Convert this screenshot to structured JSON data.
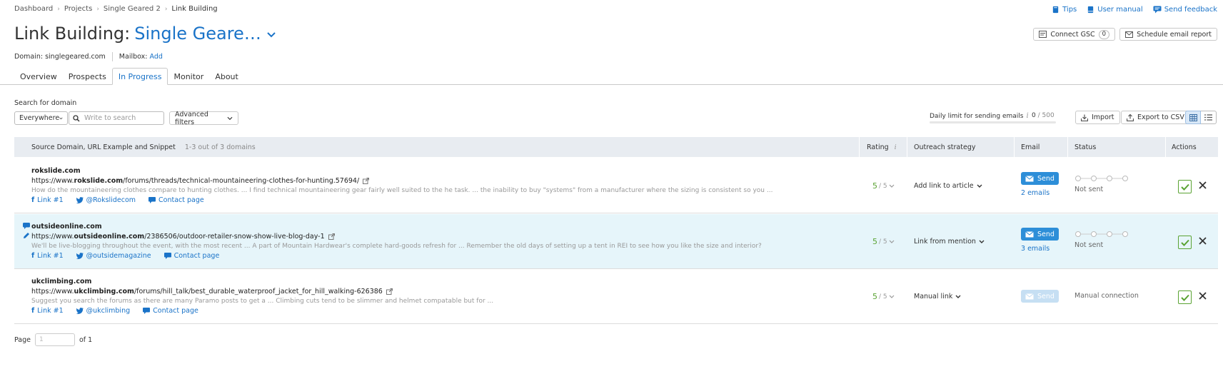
{
  "breadcrumb": [
    "Dashboard",
    "Projects",
    "Single Geared 2",
    "Link Building"
  ],
  "top_links": {
    "tips": "Tips",
    "manual": "User manual",
    "feedback": "Send feedback"
  },
  "title": {
    "prefix": "Link Building:",
    "project": "Single Geare…"
  },
  "header_buttons": {
    "gsc": "Connect GSC",
    "gsc_count": "0",
    "schedule": "Schedule email report"
  },
  "meta": {
    "domain": "Domain: singlegeared.com",
    "mailbox_label": "Mailbox:",
    "mailbox_add": "Add"
  },
  "tabs": [
    {
      "label": "Overview"
    },
    {
      "label": "Prospects"
    },
    {
      "label": "In Progress"
    },
    {
      "label": "Monitor"
    },
    {
      "label": "About"
    }
  ],
  "search": {
    "label": "Search for domain",
    "scope": "Everywhere",
    "placeholder": "Write to search",
    "advanced": "Advanced filters"
  },
  "daily_limit": {
    "label": "Daily limit for sending emails",
    "used": "0",
    "sep": "/",
    "total": "500",
    "progress": 0
  },
  "actions": {
    "import": "Import",
    "export": "Export to CSV"
  },
  "table": {
    "headers": {
      "source": "Source Domain, URL Example and Snippet",
      "count": "1-3 out of 3 domains",
      "rating": "Rating",
      "strategy": "Outreach strategy",
      "email": "Email",
      "status": "Status",
      "actions": "Actions"
    },
    "rows": [
      {
        "domain": "rokslide.com",
        "url_prefix": "https://www.",
        "url_domain": "rokslide.com",
        "url_path": "/forums/threads/technical-mountaineering-clothes-for-hunting.57694/",
        "snippet": "How do the mountaineering clothes compare to hunting clothes. ... I find technical mountaineering gear fairly well suited to the he task. ... the inability to buy \"systems\" from a manufacturer where the sizing is consistent so you ...",
        "link": "Link #1",
        "twitter": "@Rokslidecom",
        "contact": "Contact page",
        "rating": "5",
        "rating_of": "/ 5",
        "strategy": "Add link to article",
        "send": "Send",
        "emails": "2 emails",
        "status": "Not sent"
      },
      {
        "domain": "outsideonline.com",
        "url_prefix": "https://www.",
        "url_domain": "outsideonline.com",
        "url_path": "/2386506/outdoor-retailer-snow-show-live-blog-day-1",
        "snippet": "We'll be live-blogging throughout the event, with the most recent ... A part of Mountain Hardwear's complete hard-goods refresh for ... Remember the old days of setting up a tent in REI to see how you like the size and interior?",
        "link": "Link #1",
        "twitter": "@outsidemagazine",
        "contact": "Contact page",
        "rating": "5",
        "rating_of": "/ 5",
        "strategy": "Link from mention",
        "send": "Send",
        "emails": "3 emails",
        "status": "Not sent"
      },
      {
        "domain": "ukclimbing.com",
        "url_prefix": "https://www.",
        "url_domain": "ukclimbing.com",
        "url_path": "/forums/hill_talk/best_durable_waterproof_jacket_for_hill_walking-626386",
        "snippet": "Suggest you search the forums as there are many Paramo posts to get a ... Climbing cuts tend to be slimmer and helmet compatable but for ...",
        "link": "Link #1",
        "twitter": "@ukclimbing",
        "contact": "Contact page",
        "rating": "5",
        "rating_of": "/ 5",
        "strategy": "Manual link",
        "send": "Send",
        "emails": "",
        "status": "Manual connection"
      }
    ]
  },
  "pager": {
    "label": "Page",
    "placeholder": "1",
    "of": "of 1"
  },
  "colors": {
    "accent": "#1a73c8",
    "send": "#2d8ed8",
    "rating": "#5aa333",
    "header_bg": "#e8ecf1",
    "highlight_row": "#e6f5fa"
  }
}
